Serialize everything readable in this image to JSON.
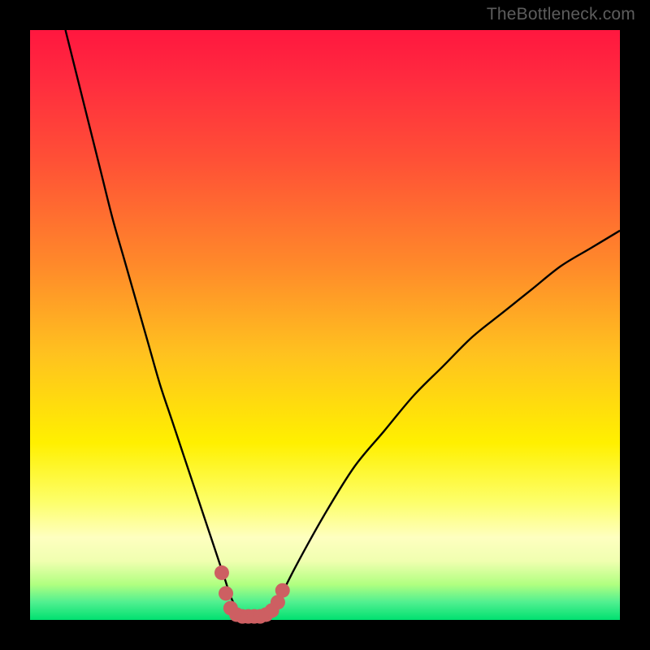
{
  "watermark": "TheBottleneck.com",
  "colors": {
    "frame": "#000000",
    "curve_stroke": "#000000",
    "marker_fill": "#cd5f62",
    "gradient_top": "#ff173f",
    "gradient_bottom": "#00e070"
  },
  "chart_data": {
    "type": "line",
    "title": "",
    "xlabel": "",
    "ylabel": "",
    "xlim": [
      0,
      100
    ],
    "ylim": [
      0,
      100
    ],
    "grid": false,
    "series": [
      {
        "name": "bottleneck-curve",
        "x": [
          6,
          8,
          10,
          12,
          14,
          16,
          18,
          20,
          22,
          24,
          26,
          28,
          30,
          32,
          33,
          34,
          35,
          36,
          37,
          38,
          39,
          40,
          41,
          42,
          45,
          50,
          55,
          60,
          65,
          70,
          75,
          80,
          85,
          90,
          95,
          100
        ],
        "values": [
          100,
          92,
          84,
          76,
          68,
          61,
          54,
          47,
          40,
          34,
          28,
          22,
          16,
          10,
          7,
          4,
          2,
          1,
          0,
          0,
          0,
          0,
          1,
          3,
          9,
          18,
          26,
          32,
          38,
          43,
          48,
          52,
          56,
          60,
          63,
          66
        ]
      }
    ],
    "markers": {
      "name": "valley-markers",
      "fill": "#cd5f62",
      "points": [
        {
          "x": 32.5,
          "y": 8
        },
        {
          "x": 33.2,
          "y": 4.5
        },
        {
          "x": 34.0,
          "y": 2.0
        },
        {
          "x": 35.0,
          "y": 0.9
        },
        {
          "x": 36.0,
          "y": 0.6
        },
        {
          "x": 37.0,
          "y": 0.6
        },
        {
          "x": 38.0,
          "y": 0.6
        },
        {
          "x": 39.0,
          "y": 0.6
        },
        {
          "x": 40.0,
          "y": 0.9
        },
        {
          "x": 41.0,
          "y": 1.6
        },
        {
          "x": 42.0,
          "y": 3.0
        },
        {
          "x": 42.8,
          "y": 5.0
        }
      ]
    }
  }
}
